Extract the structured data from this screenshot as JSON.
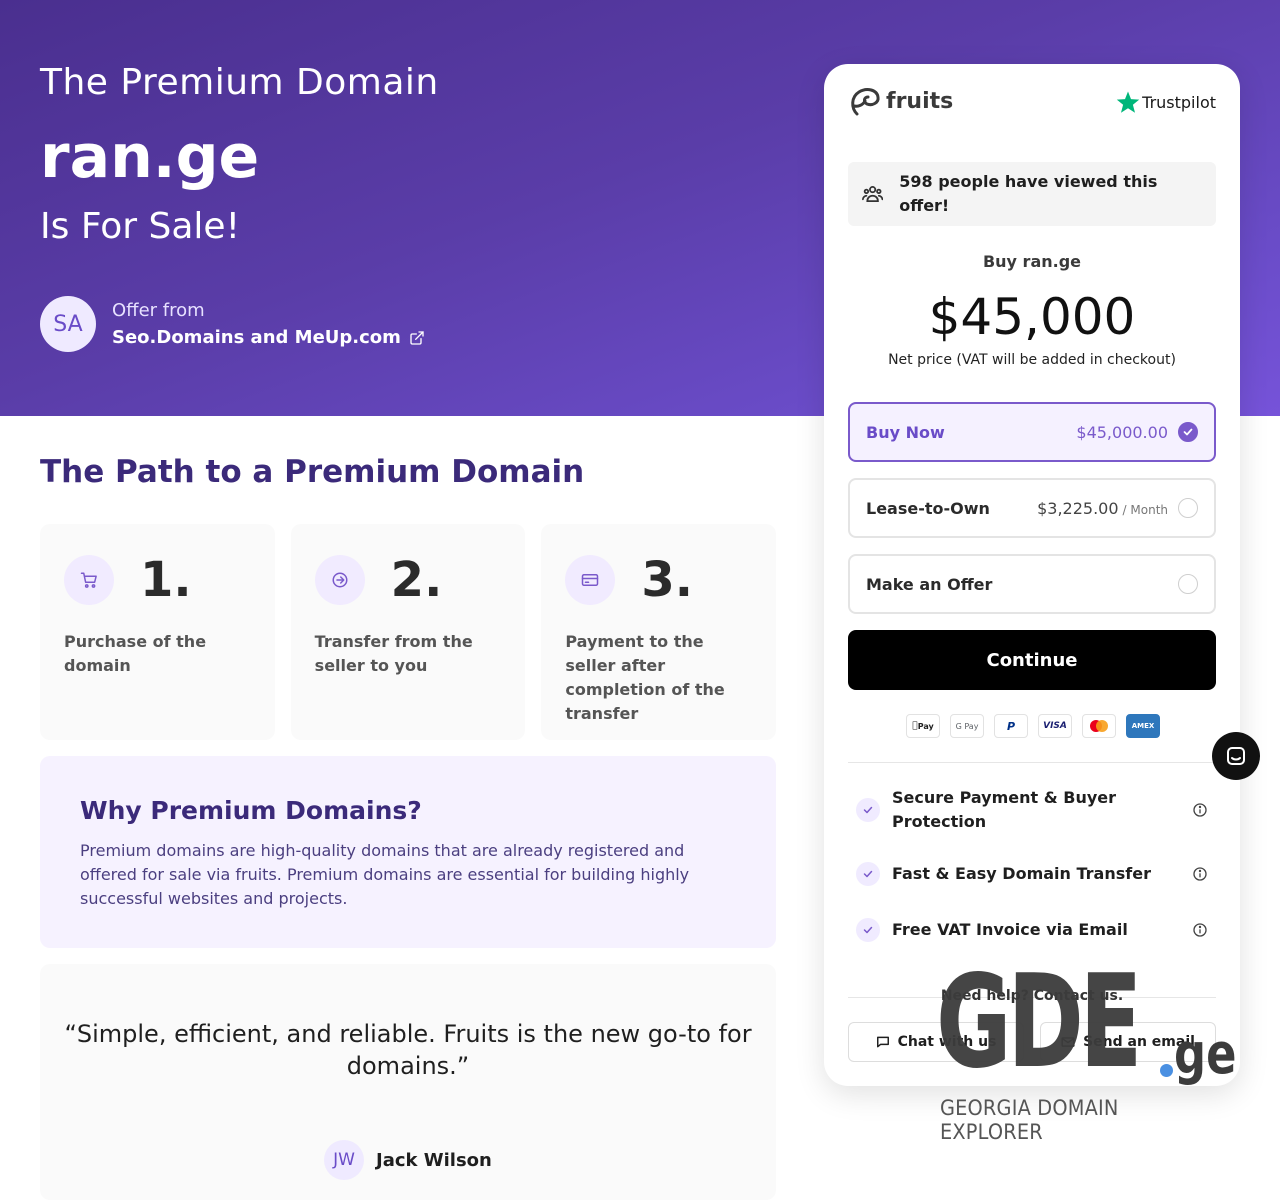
{
  "hero": {
    "kicker": "The Premium Domain",
    "domain": "ran.ge",
    "sale": "Is For Sale!",
    "seller_initials": "SA",
    "seller_label": "Offer from",
    "seller_name": "Seo.Domains and MeUp.com"
  },
  "path": {
    "title": "The Path to a Premium Domain",
    "steps": [
      {
        "num": "1.",
        "text": "Purchase of the domain",
        "icon": "cart-icon"
      },
      {
        "num": "2.",
        "text": "Transfer from the seller to you",
        "icon": "arrow-circle-icon"
      },
      {
        "num": "3.",
        "text": "Payment to the seller after completion of the transfer",
        "icon": "card-icon"
      }
    ]
  },
  "why": {
    "title": "Why Premium Domains?",
    "text": "Premium domains are high-quality domains that are already registered and offered for sale via fruits. Premium domains are essential for building highly successful websites and projects."
  },
  "testimonial": {
    "quote": "“Simple, efficient, and reliable. Fruits is the new go-to for domains.”",
    "initials": "JW",
    "name": "Jack Wilson"
  },
  "card": {
    "brand": "fruits",
    "trustpilot": "Trustpilot",
    "views": "598 people have viewed this offer!",
    "buy_label": "Buy ran.ge",
    "price": "$45,000",
    "net": "Net price (VAT will be added in checkout)",
    "options": [
      {
        "label": "Buy Now",
        "price": "$45,000.00",
        "unit": "",
        "selected": true
      },
      {
        "label": "Lease-to-Own",
        "price": "$3,225.00",
        "unit": "/ Month",
        "selected": false
      },
      {
        "label": "Make an Offer",
        "price": "",
        "unit": "",
        "selected": false
      }
    ],
    "continue": "Continue",
    "payments": [
      "Pay",
      "G Pay",
      "P",
      "VISA",
      "",
      "AMEX"
    ],
    "features": [
      "Secure Payment & Buyer Protection",
      "Fast & Easy Domain Transfer",
      "Free VAT Invoice via Email"
    ],
    "help": "Need help? Contact us.",
    "chat": "Chat with us",
    "email": "Send an email"
  },
  "watermark": {
    "letters": "GDE",
    "tld": "ge",
    "subtitle": "GEORGIA DOMAIN EXPLORER"
  },
  "colors": {
    "accent": "#6a4cc8",
    "heading": "#3b2a7a",
    "hero_start": "#4a2f8f",
    "hero_end": "#7653d9",
    "trustpilot_green": "#00b67a"
  }
}
